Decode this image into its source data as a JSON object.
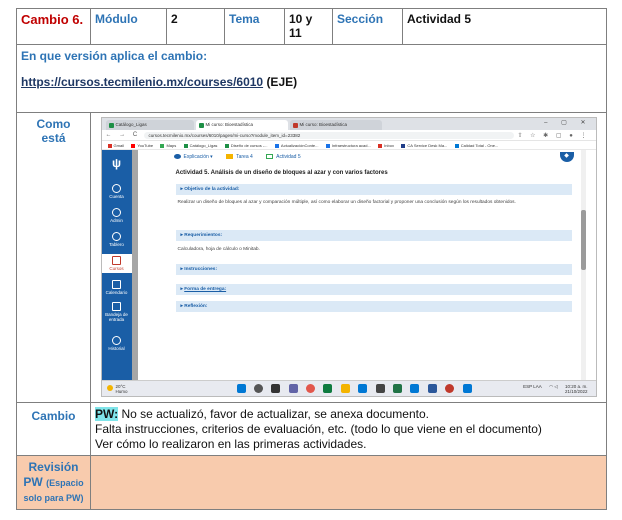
{
  "header": {
    "cambio": "Cambio 6.",
    "modulo_label": "Módulo",
    "modulo_value": "2",
    "tema_label": "Tema",
    "tema_value": "10 y 11",
    "seccion_label": "Sección",
    "seccion_value": "Actividad 5"
  },
  "version": {
    "question": "En que versión aplica el cambio:",
    "url": "https://cursos.tecmilenio.mx/courses/6010",
    "suffix": "(EJE)"
  },
  "como_esta": {
    "label_line1": "Como",
    "label_line2": "está",
    "screenshot": {
      "tabs": [
        "Catálogo_Ligas",
        "Mi curso: Bioestadística",
        "Mi curso: Bioestadística"
      ],
      "window_controls": "– ▢ ✕",
      "nav_buttons": "← → C",
      "url": "cursos.tecmilenio.mx/courses/6010/pages/mi-curso?module_item_id=23382",
      "right_icons": "⇧ ☆ ✱ ▢ ● ⋮",
      "bookmarks": [
        "Gmail",
        "YouTube",
        "Maps",
        "Catálogo_Ligas",
        "Diseño de cursos -...",
        "ActualizaciónConte...",
        "Infraestructura acad...",
        "Inbox",
        "CA Service Desk Ma...",
        "Calidad Total - One..."
      ],
      "sidebar": [
        "Cuenta",
        "Admin",
        "Tablero",
        "Cursos",
        "Calendario",
        "Bandeja de entrada",
        "Historial"
      ],
      "content_tabs": [
        "Explicación ▾",
        "Tarea 4",
        "Actividad 5"
      ],
      "activity_title": "Actividad 5. Análisis de un diseño de bloques al azar y con varios factores",
      "sections": [
        {
          "title": "Objetivo de la actividad:",
          "body": "Realizar un diseño de bloques al azar y comparación múltiple, así como elaborar un diseño factorial y proponer una conclusión según los resultados obtenidos."
        },
        {
          "title": "Requerimientos:",
          "body": "Calculadora, hoja de cálculo o Minitab."
        },
        {
          "title": "Instrucciones:",
          "body": ""
        },
        {
          "title": "Forma de entrega:",
          "body": ""
        },
        {
          "title": "Reflexión:",
          "body": ""
        }
      ],
      "taskbar": {
        "weather_temp": "20°C",
        "weather_desc": "Humo",
        "lang": "ESP LAA",
        "time": "10:20 a. m.",
        "date": "21/10/2022"
      }
    }
  },
  "cambio_row": {
    "label": "Cambio",
    "pw": "PW:",
    "line1": " No se actualizó, favor de actualizar, se anexa documento.",
    "line2": "Falta instrucciones, criterios de evaluación, etc. (todo lo que viene en el documento)",
    "line3": "Ver cómo lo realizaron en las primeras actividades."
  },
  "revision": {
    "title": "Revisión",
    "pw": "PW",
    "sub1": "(Espacio",
    "sub2": "solo para PW)"
  },
  "colors": {
    "cambio_red": "#c00000",
    "label_blue": "#2e74b5",
    "pw_highlight": "#7fe5ea",
    "revision_bg": "#f8cbad",
    "lms_blue": "#1a5ea6"
  }
}
